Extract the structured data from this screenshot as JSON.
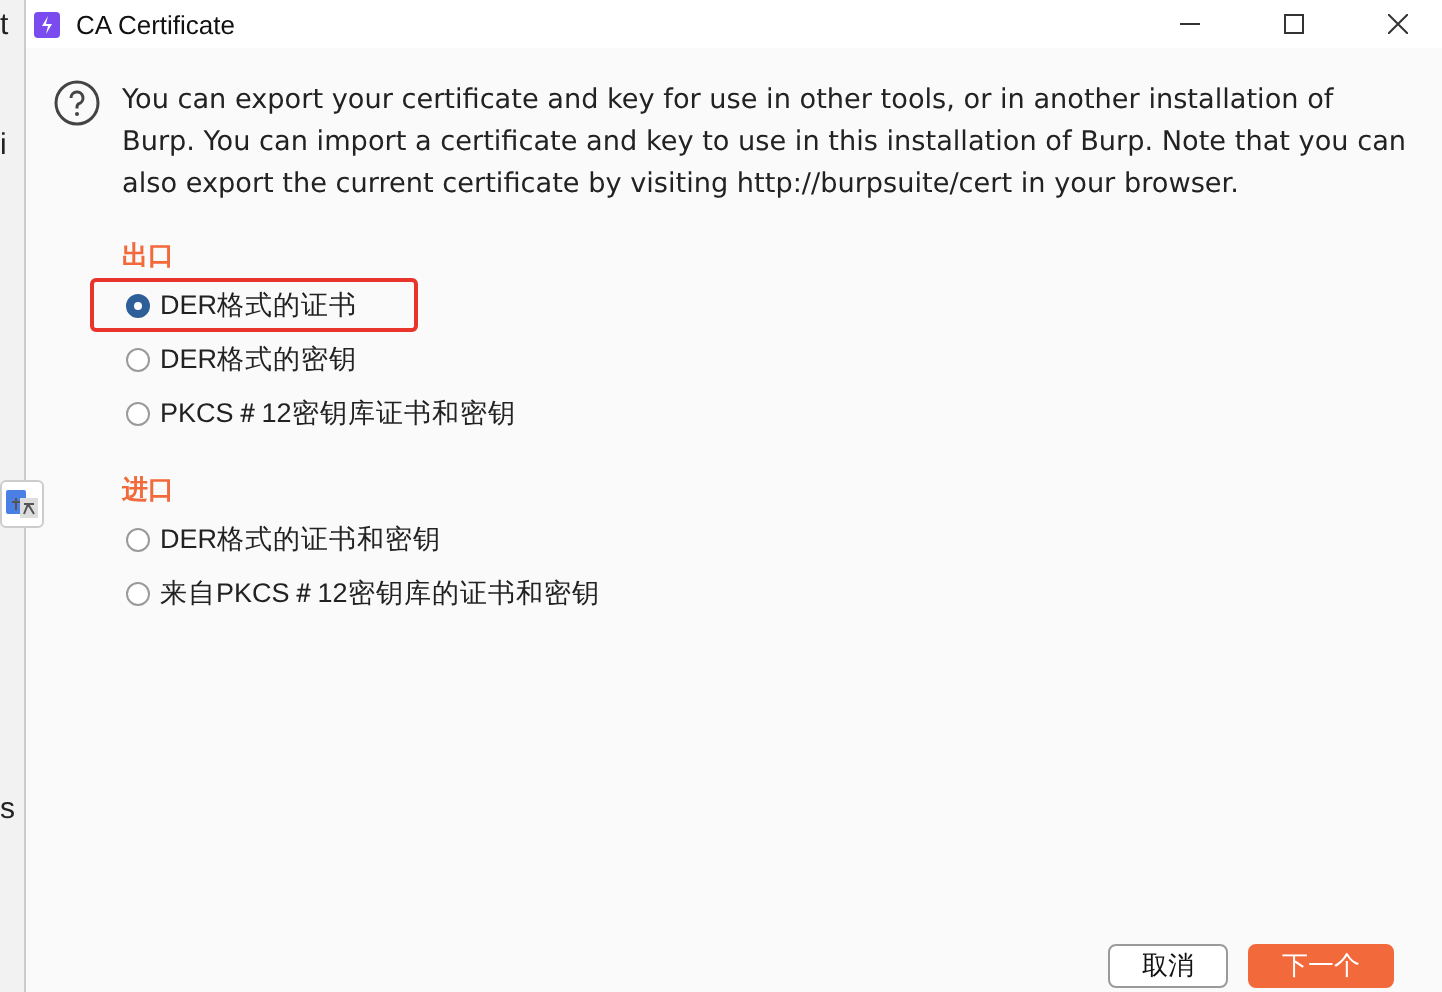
{
  "background": {
    "fragments": [
      "t",
      "i",
      "s"
    ]
  },
  "window": {
    "title": "CA Certificate"
  },
  "info": "You can export your certificate and key for use in other tools, or in another installation of Burp. You can import a certificate and key to use in this installation of Burp. Note that you can also export the current certificate by visiting http://burpsuite/cert in your browser.",
  "groups": [
    {
      "heading": "出口",
      "options": [
        {
          "label": "DER格式的证书",
          "selected": true,
          "highlighted": true
        },
        {
          "label": "DER格式的密钥",
          "selected": false,
          "highlighted": false
        },
        {
          "label": "PKCS＃12密钥库证书和密钥",
          "selected": false,
          "highlighted": false
        }
      ]
    },
    {
      "heading": "进口",
      "options": [
        {
          "label": "DER格式的证书和密钥",
          "selected": false,
          "highlighted": false
        },
        {
          "label": "来自PKCS＃12密钥库的证书和密钥",
          "selected": false,
          "highlighted": false
        }
      ]
    }
  ],
  "buttons": [
    {
      "label": "取消",
      "kind": "secondary"
    },
    {
      "label": "下一个",
      "kind": "primary"
    }
  ]
}
